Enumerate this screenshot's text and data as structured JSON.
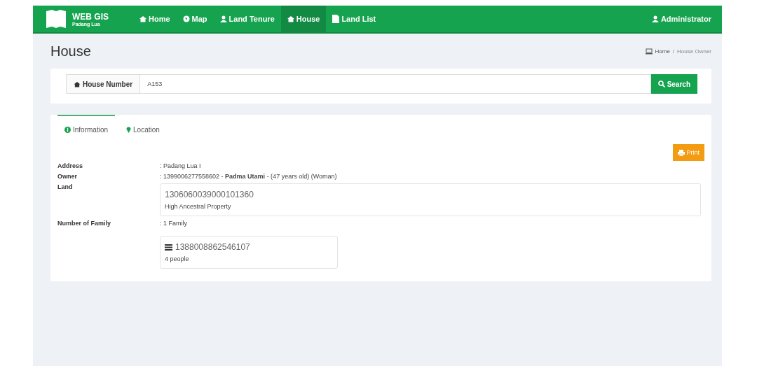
{
  "brand": {
    "title": "WEB GIS",
    "subtitle": "Padang Lua"
  },
  "nav": [
    {
      "label": "Home",
      "selected": false
    },
    {
      "label": "Map",
      "selected": false
    },
    {
      "label": "Land Tenure",
      "selected": false
    },
    {
      "label": "House",
      "selected": true
    },
    {
      "label": "Land List",
      "selected": false
    }
  ],
  "user": "Administrator",
  "page_title": "House",
  "breadcrumb": [
    "Home",
    "House Owner"
  ],
  "breadcrumb_separator": "/",
  "search": {
    "label": "House Number",
    "value": "A153",
    "button": "Search"
  },
  "tabs": [
    {
      "label": "Information",
      "selected": true
    },
    {
      "label": "Location",
      "selected": false
    }
  ],
  "print_button": "Print",
  "details": [
    {
      "label": "Address",
      "value": ": Padang Lua I"
    },
    {
      "label": "Owner",
      "value": ": 1399006277558602 - **Padma Utami** - (47 years old) (Woman)"
    }
  ],
  "land": {
    "label": "Land",
    "code": "1306060039000101360",
    "type": "High Ancestral Property"
  },
  "family": {
    "label": "Number of Family",
    "value": ": 1 Family",
    "card_code": "1388008862546107",
    "card_people": "4 people"
  }
}
